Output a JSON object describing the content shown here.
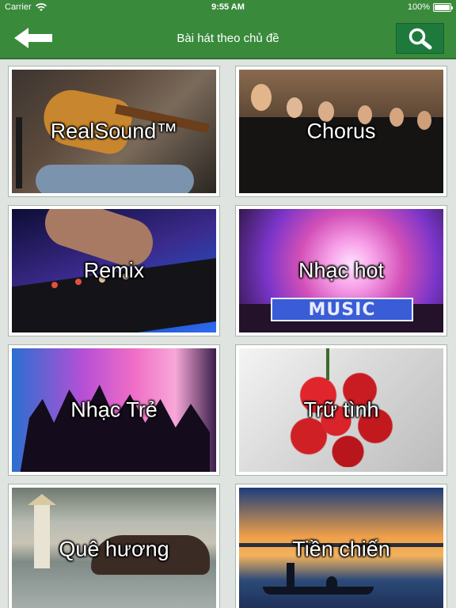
{
  "status_bar": {
    "carrier": "Carrier",
    "time": "9:55 AM",
    "battery": "100%",
    "battery_level": 1.0
  },
  "nav": {
    "title": "Bài hát theo chủ đề",
    "back_icon": "arrow-left-icon",
    "search_icon": "search-icon"
  },
  "colors": {
    "header": "#3a8a3c",
    "search_button": "#1e7a3c",
    "background": "#dfe4e1"
  },
  "categories": [
    {
      "label": "RealSound™"
    },
    {
      "label": "Chorus"
    },
    {
      "label": "Remix"
    },
    {
      "label": "Nhạc hot"
    },
    {
      "label": "Nhạc Trẻ"
    },
    {
      "label": "Trữ tình"
    },
    {
      "label": "Quê hương"
    },
    {
      "label": "Tiền chiến"
    }
  ],
  "decor_text": {
    "music_banner": "MUSIC"
  }
}
